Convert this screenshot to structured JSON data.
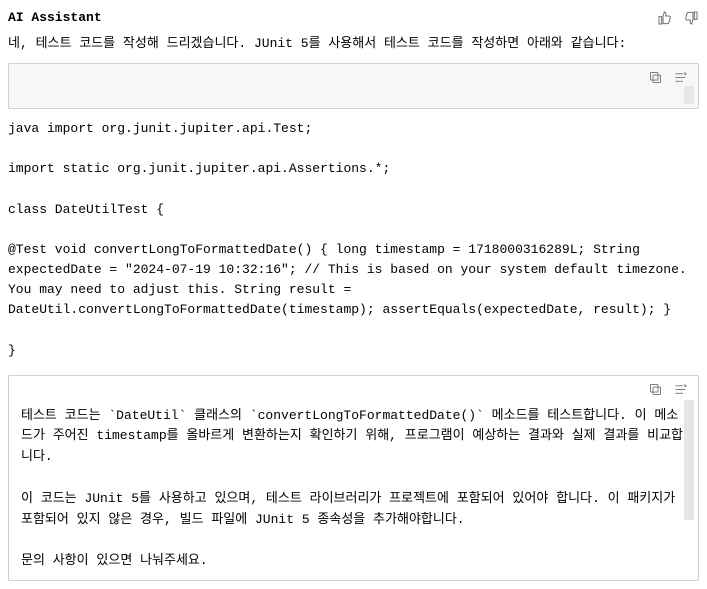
{
  "header": {
    "title": "AI Assistant"
  },
  "intro": "네, 테스트 코드를 작성해 드리겠습니다. JUnit 5를 사용해서 테스트 코드를 작성하면 아래와 같습니다:",
  "code": "java import org.junit.jupiter.api.Test;\n\nimport static org.junit.jupiter.api.Assertions.*;\n\nclass DateUtilTest {\n\n@Test void convertLongToFormattedDate() { long timestamp = 1718000316289L; String expectedDate = \"2024-07-19 10:32:16\"; // This is based on your system default timezone. You may need to adjust this. String result = DateUtil.convertLongToFormattedDate(timestamp); assertEquals(expectedDate, result); }\n\n}",
  "explanation": "테스트 코드는 `DateUtil` 클래스의 `convertLongToFormattedDate()` 메소드를 테스트합니다. 이 메소드가 주어진 timestamp를 올바르게 변환하는지 확인하기 위해, 프로그램이 예상하는 결과와 실제 결과를 비교합니다.\n\n이 코드는 JUnit 5를 사용하고 있으며, 테스트 라이브러리가 프로젝트에 포함되어 있어야 합니다. 이 패키지가 포함되어 있지 않은 경우, 빌드 파일에 JUnit 5 종속성을 추가해야합니다.\n\n문의 사항이 있으면 나눠주세요."
}
